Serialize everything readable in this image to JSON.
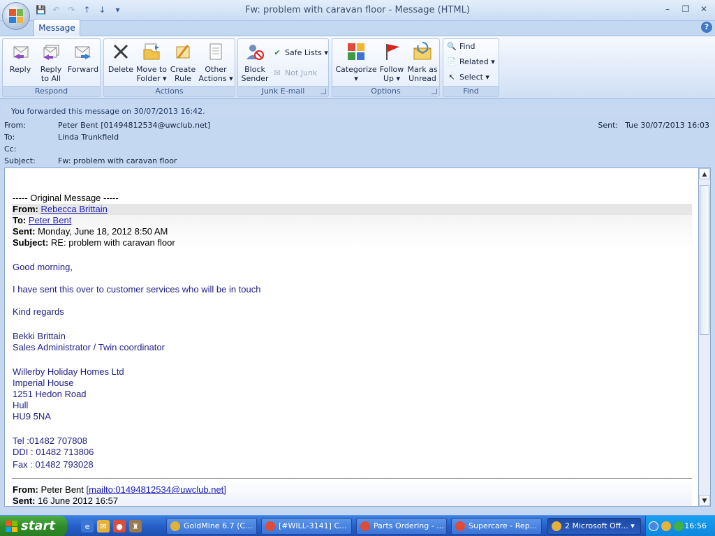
{
  "window": {
    "title": "Fw: problem with caravan floor - Message (HTML)",
    "tab": "Message",
    "help_glyph": "?",
    "min_glyph": "–",
    "max_glyph": "❐",
    "close_glyph": "✕"
  },
  "quick_access": {
    "save": "💾",
    "undo": "↶",
    "redo": "↷",
    "prev": "↑",
    "next": "↓",
    "customize": "▾"
  },
  "ribbon": {
    "respond": {
      "label": "Respond",
      "reply": "Reply",
      "reply_all_1": "Reply",
      "reply_all_2": "to All",
      "forward": "Forward"
    },
    "actions": {
      "label": "Actions",
      "delete": "Delete",
      "move_1": "Move to",
      "move_2": "Folder ▾",
      "create_1": "Create",
      "create_2": "Rule",
      "other_1": "Other",
      "other_2": "Actions ▾"
    },
    "junk": {
      "label": "Junk E-mail",
      "block_1": "Block",
      "block_2": "Sender",
      "safe_lists": "Safe Lists ▾",
      "not_junk": "Not Junk"
    },
    "options": {
      "label": "Options",
      "categorize_1": "Categorize",
      "categorize_2": "▾",
      "follow_1": "Follow",
      "follow_2": "Up ▾",
      "mark_1": "Mark as",
      "mark_2": "Unread"
    },
    "find": {
      "label": "Find",
      "find": "Find",
      "related": "Related ▾",
      "select": "Select ▾"
    }
  },
  "infobar": "You forwarded this message on 30/07/2013 16:42.",
  "header": {
    "from_label": "From:",
    "from": "Peter Bent [01494812534@uwclub.net]",
    "to_label": "To:",
    "to": "Linda Trunkfield",
    "cc_label": "Cc:",
    "cc": "",
    "subject_label": "Subject:",
    "subject": "Fw: problem with caravan floor",
    "sent_label": "Sent:",
    "sent": "Tue 30/07/2013 16:03"
  },
  "body": {
    "original_marker": "----- Original Message -----",
    "orig_from_label": "From:",
    "orig_from": "Rebecca Brittain",
    "orig_to_label": "To:",
    "orig_to": "Peter Bent",
    "orig_sent_label": "Sent:",
    "orig_sent": "Monday, June 18, 2012 8:50 AM",
    "orig_subject_label": "Subject:",
    "orig_subject": "RE: problem with caravan floor",
    "greeting": "Good morning,",
    "para1": "I have sent this over to customer services who will be in touch",
    "regards": "Kind regards",
    "sig_name": "Bekki Brittain",
    "sig_title": "Sales Administrator / Twin coordinator",
    "company": "Willerby Holiday Homes Ltd",
    "addr1": "Imperial House",
    "addr2": "1251 Hedon Road",
    "addr3": "Hull",
    "addr4": "HU9 5NA",
    "tel": "Tel :01482 707808",
    "ddi": "DDI : 01482 713806",
    "fax": "Fax : 01482 793028",
    "prev_from_label": "From:",
    "prev_from_name": "Peter Bent ",
    "prev_from_link": "[mailto:01494812534@uwclub.net]",
    "prev_sent_label": "Sent:",
    "prev_sent": "16 June 2012 16:57"
  },
  "taskbar": {
    "start": "start",
    "items": [
      "GoldMine 6.7 (C...",
      "[#WILL-3141] C...",
      "Parts Ordering - ...",
      "Supercare - Rep...",
      "2 Microsoft Off..."
    ],
    "active_arrow": "▾",
    "clock": "16:56"
  },
  "colors": {
    "accent": "#15428b",
    "ribbon_bg": "#dbe7f8",
    "link": "#1c1cbb",
    "taskbar": "#2760c9",
    "start": "#2f8c2a"
  }
}
